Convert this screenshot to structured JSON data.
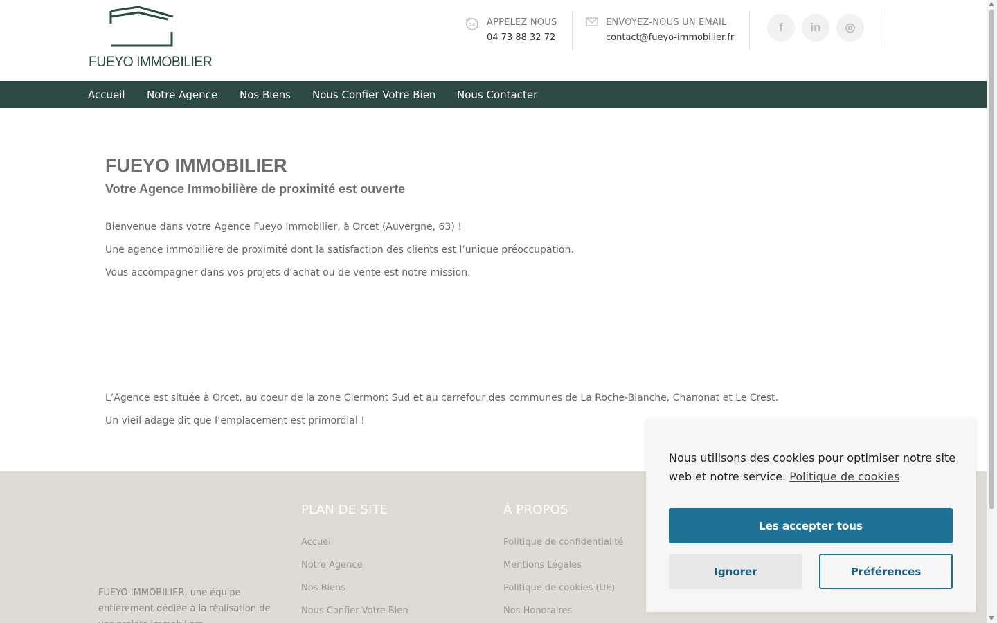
{
  "header": {
    "logo_text": "FUEYO IMMOBILIER",
    "phone": {
      "label": "APPELEZ NOUS",
      "value": "04 73 88 32 72"
    },
    "email": {
      "label": "ENVOYEZ-NOUS UN EMAIL",
      "value": "contact@fueyo-immobilier.fr"
    },
    "social": [
      {
        "name": "facebook-icon",
        "glyph": "f"
      },
      {
        "name": "linkedin-icon",
        "glyph": "in"
      },
      {
        "name": "instagram-icon",
        "glyph": "◎"
      }
    ]
  },
  "nav": {
    "items": [
      {
        "label": "Accueil"
      },
      {
        "label": "Notre Agence"
      },
      {
        "label": "Nos Biens"
      },
      {
        "label": "Nous Confier Votre Bien"
      },
      {
        "label": "Nous Contacter"
      }
    ]
  },
  "main": {
    "title": "FUEYO IMMOBILIER",
    "subtitle": "Votre Agence Immobilière de proximité est ouverte",
    "paragraphs": [
      "Bienvenue dans votre Agence Fueyo Immobilier, à Orcet (Auvergne, 63) !",
      "Une agence immobilière de proximité dont la satisfaction des clients est l’unique préoccupation.",
      "Vous accompagner dans vos projets d’achat ou de vente est notre mission.",
      "L’Agence est située à Orcet, au coeur de la zone Clermont Sud et au carrefour des communes de La Roche-Blanche, Chanonat et Le Crest.",
      "Un vieil adage dit que l’emplacement est primordial !"
    ]
  },
  "footer": {
    "description": "FUEYO IMMOBILIER, une équipe entièrement dédiée à la réalisation de vos projets immobiliers",
    "sitemap": {
      "title": "PLAN DE SITE",
      "links": [
        "Accueil",
        "Notre Agence",
        "Nos Biens",
        "Nous Confier Votre Bien"
      ]
    },
    "about": {
      "title": "À PROPOS",
      "links": [
        "Politique de confidentialité",
        "Mentions Légales",
        "Politique de cookies (UE)",
        "Nos Honoraires"
      ]
    }
  },
  "cookie": {
    "text": "Nous utilisons des cookies pour optimiser notre site web et notre service.",
    "link": "Politique de cookies",
    "accept": "Les accepter tous",
    "ignore": "Ignorer",
    "preferences": "Préférences"
  },
  "colors": {
    "nav_bg": "#2c4a43",
    "footer_bg": "#dedad4",
    "accent_blue": "#1f7195"
  }
}
